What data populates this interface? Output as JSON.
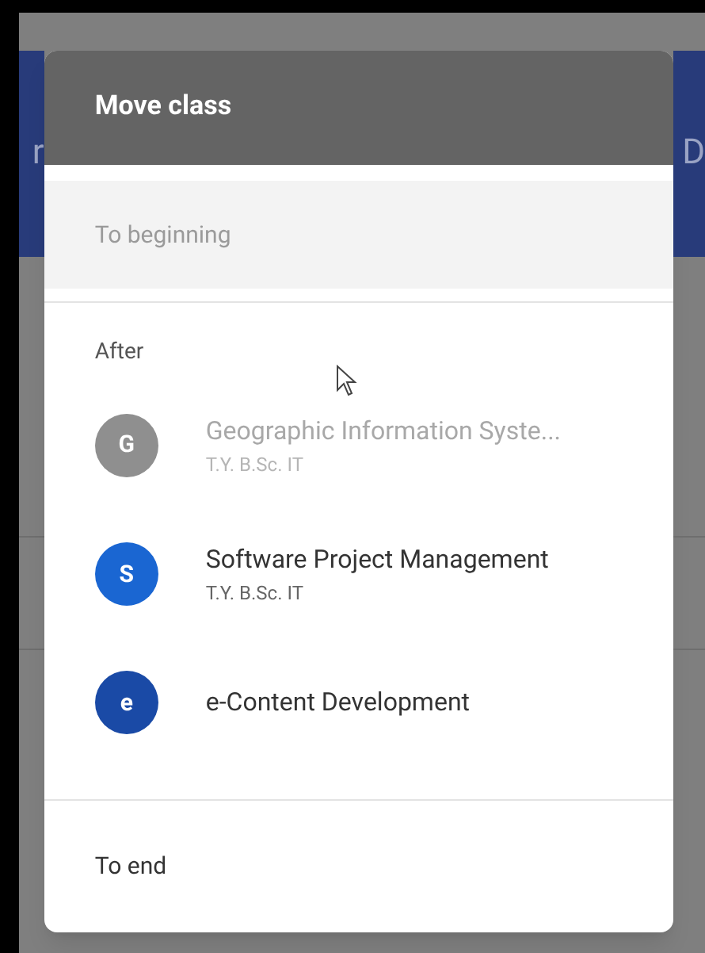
{
  "background": {
    "left_text": "r",
    "right_text": "D"
  },
  "dialog": {
    "title": "Move class",
    "to_beginning": {
      "label": "To beginning",
      "disabled": true
    },
    "section_label": "After",
    "classes": [
      {
        "initial": "G",
        "name": "Geographic Information Syste...",
        "section": "T.Y. B.Sc. IT",
        "color": "#8f8f8f",
        "disabled": true
      },
      {
        "initial": "S",
        "name": "Software Project Management",
        "section": "T.Y. B.Sc. IT",
        "color": "#1a66d2",
        "disabled": false
      },
      {
        "initial": "e",
        "name": "e-Content Development",
        "color": "#1a4aa6",
        "disabled": false
      }
    ],
    "to_end": {
      "label": "To end",
      "disabled": false
    }
  }
}
